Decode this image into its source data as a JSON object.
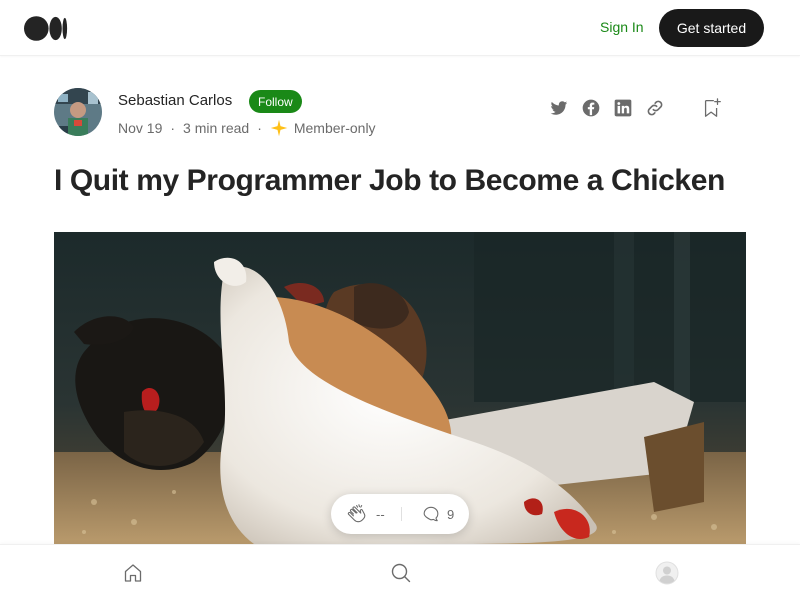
{
  "header": {
    "logo": "medium-logo",
    "sign_in_label": "Sign In",
    "get_started_label": "Get started"
  },
  "author": {
    "name": "Sebastian Carlos",
    "follow_label": "Follow",
    "date": "Nov 19",
    "read_time": "3 min read",
    "separator": "·",
    "member_label": "Member-only"
  },
  "share": {
    "icons": [
      "twitter-icon",
      "facebook-icon",
      "linkedin-icon",
      "link-icon"
    ],
    "bookmark_icon": "bookmark-add-icon"
  },
  "article": {
    "title": "I Quit my Programmer Job to Become a Chicken",
    "hero_image": "chickens-photo"
  },
  "engagement": {
    "clap_icon": "clap-icon",
    "clap_count": "--",
    "response_icon": "response-icon",
    "response_count": "9"
  },
  "bottom_nav": {
    "items": [
      "home-icon",
      "search-icon",
      "profile-icon"
    ]
  },
  "colors": {
    "accent_green": "#1a8917",
    "dark_button": "#191919",
    "text_primary": "#242424",
    "text_secondary": "#6b6b6b",
    "member_star": "#ffc017"
  }
}
